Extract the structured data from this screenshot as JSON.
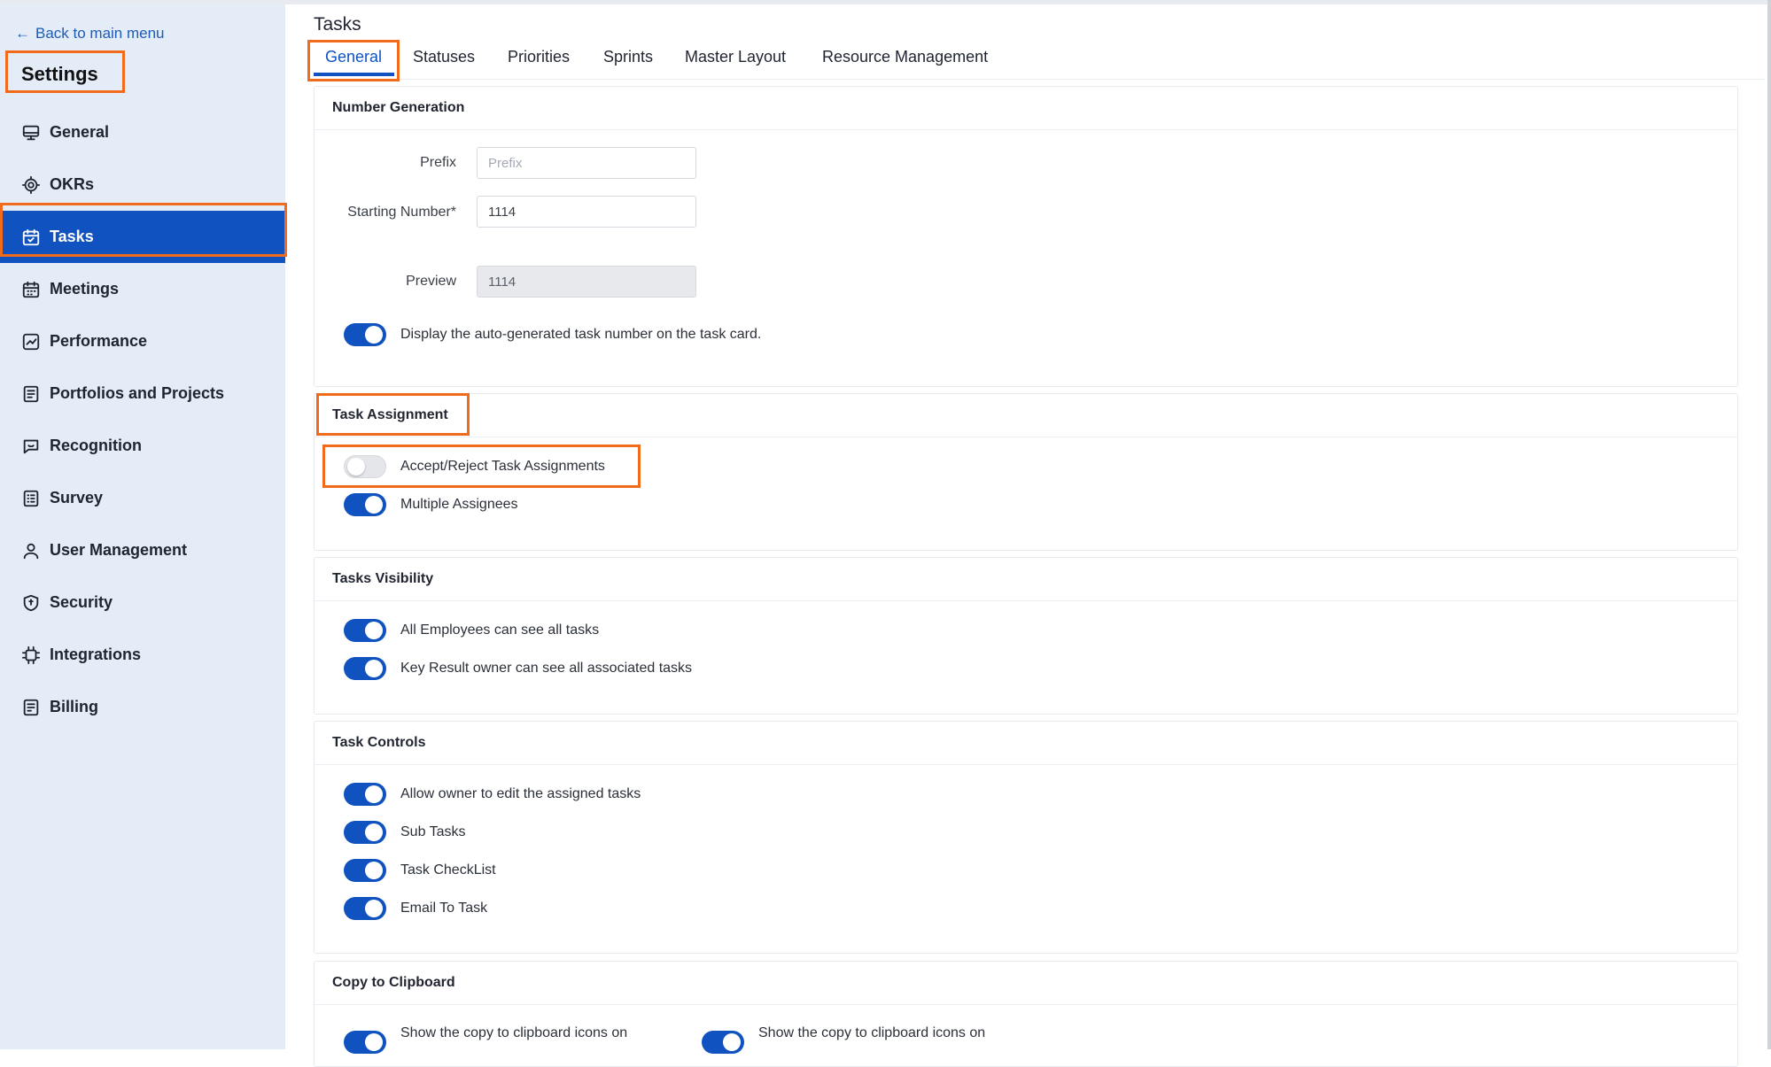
{
  "sidebar": {
    "back_label": "Back to main menu",
    "title": "Settings",
    "items": [
      {
        "label": "General",
        "icon": "monitor-icon"
      },
      {
        "label": "OKRs",
        "icon": "target-icon"
      },
      {
        "label": "Tasks",
        "icon": "calendar-check-icon",
        "active": true
      },
      {
        "label": "Meetings",
        "icon": "calendar-icon"
      },
      {
        "label": "Performance",
        "icon": "chart-line-icon"
      },
      {
        "label": "Portfolios and Projects",
        "icon": "document-list-icon"
      },
      {
        "label": "Recognition",
        "icon": "chat-smile-icon"
      },
      {
        "label": "Survey",
        "icon": "checklist-icon"
      },
      {
        "label": "User Management",
        "icon": "user-icon"
      },
      {
        "label": "Security",
        "icon": "shield-icon"
      },
      {
        "label": "Integrations",
        "icon": "chip-icon"
      },
      {
        "label": "Billing",
        "icon": "receipt-icon"
      }
    ]
  },
  "main": {
    "title": "Tasks",
    "tabs": [
      {
        "label": "General",
        "active": true
      },
      {
        "label": "Statuses"
      },
      {
        "label": "Priorities"
      },
      {
        "label": "Sprints"
      },
      {
        "label": "Master Layout"
      },
      {
        "label": "Resource Management"
      }
    ],
    "number_generation": {
      "heading": "Number Generation",
      "prefix_label": "Prefix",
      "prefix_placeholder": "Prefix",
      "prefix_value": "",
      "starting_label": "Starting Number*",
      "starting_value": "1114",
      "preview_label": "Preview",
      "preview_value": "1114",
      "display_toggle_label": "Display the auto-generated task number on the task card.",
      "display_toggle_on": true
    },
    "task_assignment": {
      "heading": "Task Assignment",
      "toggles": [
        {
          "label": "Accept/Reject Task Assignments",
          "on": false
        },
        {
          "label": "Multiple Assignees",
          "on": true
        }
      ]
    },
    "tasks_visibility": {
      "heading": "Tasks Visibility",
      "toggles": [
        {
          "label": "All Employees can see all tasks",
          "on": true
        },
        {
          "label": "Key Result owner can see all associated tasks",
          "on": true
        }
      ]
    },
    "task_controls": {
      "heading": "Task Controls",
      "toggles": [
        {
          "label": "Allow owner to edit the assigned tasks",
          "on": true
        },
        {
          "label": "Sub Tasks",
          "on": true
        },
        {
          "label": "Task CheckList",
          "on": true
        },
        {
          "label": "Email To Task",
          "on": true
        }
      ]
    },
    "copy_to_clipboard": {
      "heading": "Copy to Clipboard",
      "toggles": [
        {
          "label": "Show the copy to clipboard icons on",
          "on": true
        },
        {
          "label": "Show the copy to clipboard icons on",
          "on": true
        }
      ]
    }
  },
  "colors": {
    "accent": "#0f52c0",
    "highlight": "#f26b1d",
    "sidebar_bg": "#e3ecf7"
  }
}
